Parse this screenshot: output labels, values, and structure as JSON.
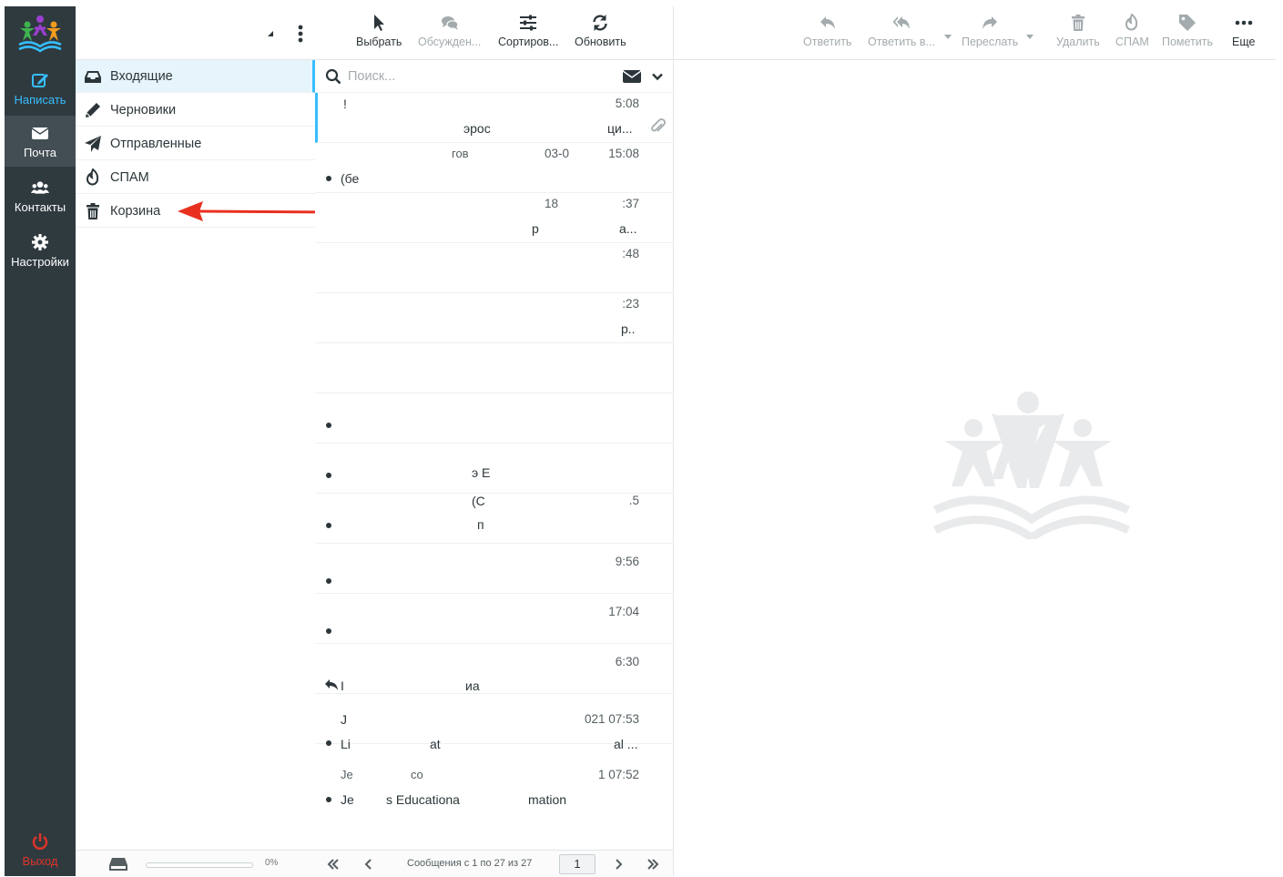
{
  "nav": {
    "compose": "Написать",
    "mail": "Почта",
    "contacts": "Контакты",
    "settings": "Настройки",
    "logout": "Выход"
  },
  "folders": [
    {
      "label": "Входящие",
      "icon": "inbox-icon",
      "selected": true
    },
    {
      "label": "Черновики",
      "icon": "pencil-icon"
    },
    {
      "label": "Отправленные",
      "icon": "paper-plane-icon"
    },
    {
      "label": "СПАМ",
      "icon": "fire-icon"
    },
    {
      "label": "Корзина",
      "icon": "trash-icon"
    }
  ],
  "quota": {
    "percent_text": "0%",
    "percent": 0
  },
  "list_toolbar": {
    "select": "Выбрать",
    "threads": "Обсужден...",
    "sort": "Сортиров...",
    "refresh": "Обновить"
  },
  "search": {
    "placeholder": "Поиск..."
  },
  "messages": [
    {
      "from": "!",
      "date": "5:08",
      "subject_mid": "эрос",
      "subject_right": "ци...",
      "attachment": true
    },
    {
      "from_mid": "гов",
      "from_right": "03-0",
      "date": "15:08",
      "subject": "(бе"
    },
    {
      "from_right": "18",
      "date": ":37",
      "subject_mid": "р",
      "subject_right": "а..."
    },
    {
      "date": ":48"
    },
    {
      "date": ":23",
      "subject_right": "р.."
    },
    {},
    {},
    {
      "subject_mid": "э Е"
    },
    {
      "from_mid": "(С",
      "date": ".5",
      "subject_mid": "п"
    },
    {
      "date": "9:56"
    },
    {
      "date": "17:04"
    },
    {
      "date": "6:30",
      "subject": "I",
      "subject_mid": "иа",
      "reply": true
    },
    {
      "from": "J",
      "date": "021 07:53",
      "subject": "Li",
      "subject_mid": "at",
      "subject_right": "al ..."
    },
    {
      "from": "Je",
      "from_mid": "co",
      "date": "1 07:52",
      "subject": "Je",
      "subject_mid": "s Educationa",
      "subject_right": "mation"
    }
  ],
  "list_footer": {
    "count_text": "Сообщения с 1 по 27 из 27",
    "page": "1"
  },
  "preview_toolbar": {
    "reply": "Ответить",
    "reply_all": "Ответить в...",
    "forward": "Переслать",
    "delete": "Удалить",
    "spam": "СПАМ",
    "mark": "Пометить",
    "more": "Еще"
  },
  "colors": {
    "accent": "#37beff",
    "nav_bg": "#2f3a3f",
    "logout": "#e0342a",
    "annotation_arrow": "#e8301f"
  }
}
